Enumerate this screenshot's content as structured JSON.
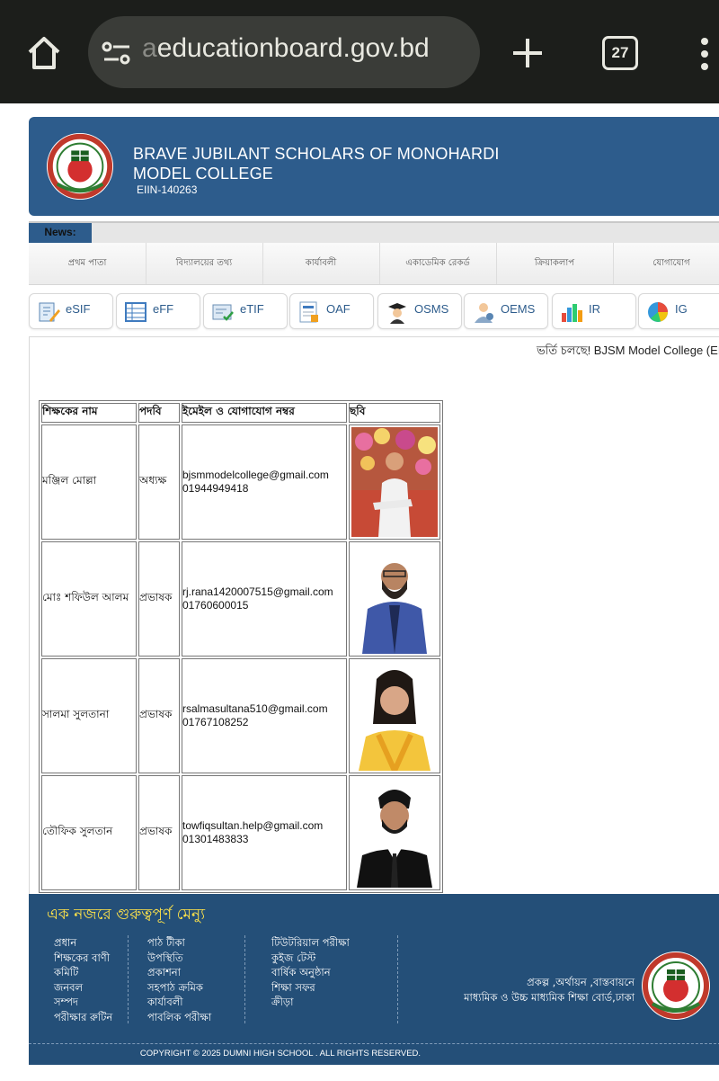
{
  "browser": {
    "url_faded": "a",
    "url": "educationboard.gov.bd",
    "tab_count": "27"
  },
  "header": {
    "school_name": "BRAVE JUBILANT SCHOLARS OF MONOHARDI MODEL COLLEGE",
    "eiin": "EIIN-140263"
  },
  "news": {
    "label": "News:",
    "ticker": "ভর্তি চলছে! BJSM Model College (EII"
  },
  "menu": [
    "প্রথম পাতা",
    "বিদ্যালয়ের তথ্য",
    "কার্যাবলী",
    "একাডেমিক রেকর্ড",
    "ক্রিয়াকলাপ",
    "যোগাযোগ"
  ],
  "services": [
    {
      "label": "eSIF",
      "icon": "form-pen-icon"
    },
    {
      "label": "eFF",
      "icon": "form-table-icon"
    },
    {
      "label": "eTIF",
      "icon": "form-check-icon"
    },
    {
      "label": "OAF",
      "icon": "document-form-icon"
    },
    {
      "label": "OSMS",
      "icon": "graduate-icon"
    },
    {
      "label": "OEMS",
      "icon": "users-icon"
    },
    {
      "label": "IR",
      "icon": "bar-chart-icon"
    },
    {
      "label": "IG",
      "icon": "pie-chart-icon"
    }
  ],
  "table": {
    "headers": [
      "শিক্ষকের নাম",
      "পদবি",
      "ইমেইল ও যোগাযোগ নম্বর",
      "ছবি"
    ],
    "rows": [
      {
        "name": "মঞ্জিল মোল্লা",
        "designation": "অধ্যক্ষ",
        "email": "bjsmmodelcollege@gmail.com",
        "phone": "01944949418"
      },
      {
        "name": "মোঃ শফিউল আলম",
        "designation": "প্রভাষক",
        "email": "rj.rana1420007515@gmail.com",
        "phone": "01760600015"
      },
      {
        "name": "সালমা সুলতানা",
        "designation": "প্রভাষক",
        "email": "rsalmasultana510@gmail.com",
        "phone": "01767108252"
      },
      {
        "name": "তৌফিক সুলতান",
        "designation": "প্রভাষক",
        "email": "towfiqsultan.help@gmail.com",
        "phone": "01301483833"
      }
    ]
  },
  "footer": {
    "title": "এক নজরে গুরুত্বপূর্ণ মেন্যু",
    "col1": [
      "প্রধান",
      "শিক্ষকের বাণী",
      "কমিটি",
      "জনবল",
      "সম্পদ",
      "পরীক্ষার রুটিন"
    ],
    "col2": [
      "পাঠ টীকা",
      "উপস্থিতি",
      "প্রকাশনা",
      "সহপাঠ ক্রমিক",
      "কার্যাবলী",
      "পাবলিক পরীক্ষা"
    ],
    "col3": [
      "টিউটরিয়াল পরীক্ষা",
      "কুইজ টেস্ট",
      "বার্ষিক অনুষ্ঠান",
      "শিক্ষা সফর",
      "ক্রীড়া"
    ],
    "credit_line1": "প্রকল্প ,অর্থায়ন ,বাস্তবায়নে",
    "credit_line2": "মাধ্যমিক ও উচ্চ মাধ্যমিক শিক্ষা বোর্ড,ঢাকা",
    "copyright": "COPYRIGHT © 2025 DUMNI HIGH SCHOOL . ALL RIGHTS RESERVED."
  }
}
